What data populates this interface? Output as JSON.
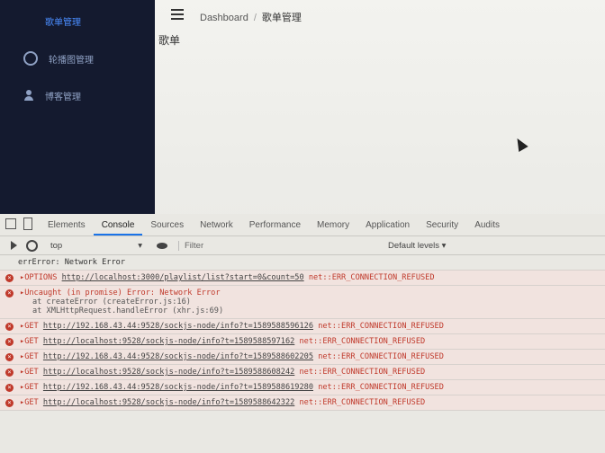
{
  "sidebar": {
    "items": [
      {
        "label": "歌单管理",
        "icon": "grid-icon"
      },
      {
        "label": "轮播图管理",
        "icon": "gear-icon"
      },
      {
        "label": "博客管理",
        "icon": "user-icon"
      }
    ]
  },
  "header": {
    "breadcrumb_root": "Dashboard",
    "breadcrumb_sep": "/",
    "breadcrumb_current": "歌单管理",
    "page_title": "歌单"
  },
  "devtools": {
    "tabs": [
      "Elements",
      "Console",
      "Sources",
      "Network",
      "Performance",
      "Memory",
      "Application",
      "Security",
      "Audits"
    ],
    "active_tab": "Console",
    "context": "top",
    "filter_placeholder": "Filter",
    "levels": "Default levels ▾"
  },
  "console": {
    "first_line": "errError: Network Error",
    "lines": [
      {
        "method": "OPTIONS",
        "url": "http://localhost:3000/playlist/list?start=0&count=50",
        "error": "net::ERR_CONNECTION_REFUSED"
      },
      {
        "method": "Uncaught (in promise) Error: Network Error",
        "url": "",
        "error": ""
      },
      {
        "method": "GET",
        "url": "http://192.168.43.44:9528/sockjs-node/info?t=1589588596126",
        "error": "net::ERR_CONNECTION_REFUSED"
      },
      {
        "method": "GET",
        "url": "http://localhost:9528/sockjs-node/info?t=1589588597162",
        "error": "net::ERR_CONNECTION_REFUSED"
      },
      {
        "method": "GET",
        "url": "http://192.168.43.44:9528/sockjs-node/info?t=1589588602205",
        "error": "net::ERR_CONNECTION_REFUSED"
      },
      {
        "method": "GET",
        "url": "http://localhost:9528/sockjs-node/info?t=1589588608242",
        "error": "net::ERR_CONNECTION_REFUSED"
      },
      {
        "method": "GET",
        "url": "http://192.168.43.44:9528/sockjs-node/info?t=1589588619280",
        "error": "net::ERR_CONNECTION_REFUSED"
      },
      {
        "method": "GET",
        "url": "http://localhost:9528/sockjs-node/info?t=1589588642322",
        "error": "net::ERR_CONNECTION_REFUSED"
      }
    ],
    "stack": [
      "at createError (createError.js:16)",
      "at XMLHttpRequest.handleError (xhr.js:69)"
    ]
  }
}
